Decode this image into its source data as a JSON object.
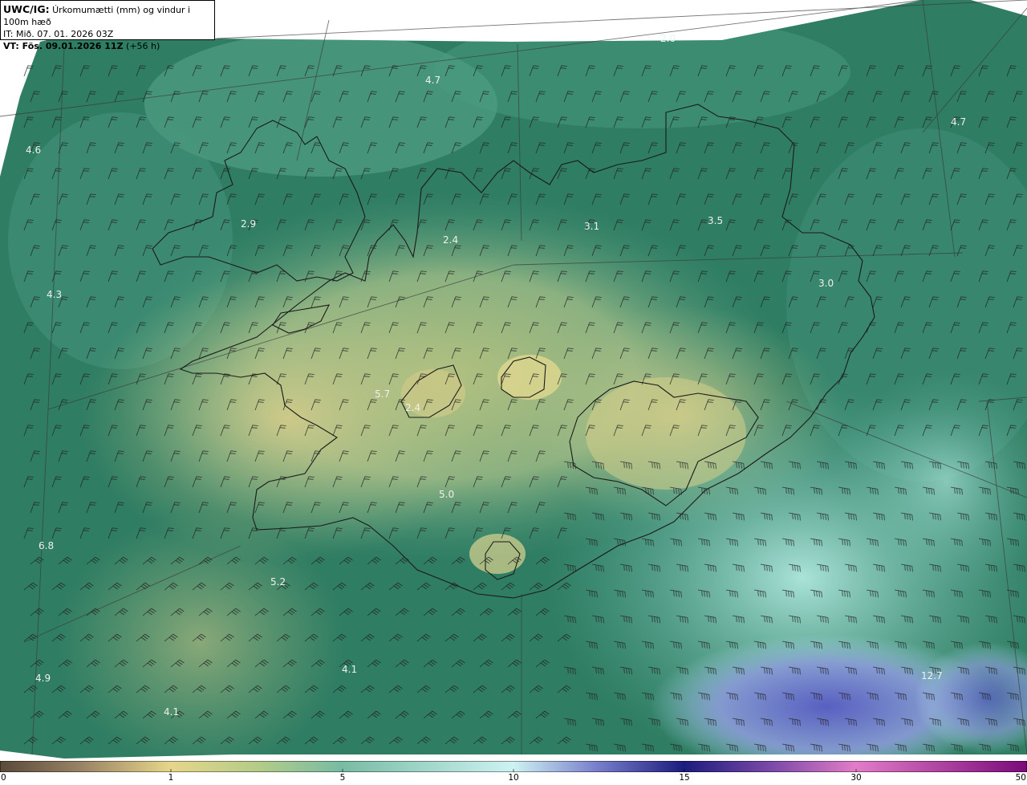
{
  "header": {
    "title_bold": "UWC/IG:",
    "title_rest": " Úrkomumætti (mm) og vindur i 100m hæð",
    "it_line": "IT: Mið. 07. 01. 2026 03Z",
    "vt_label": "VT:",
    "vt_bold": " Fös. 09.01.2026 11Z",
    "vt_rest": " (+56 h)"
  },
  "value_labels": [
    {
      "text": "4.7"
    },
    {
      "text": "2.0"
    },
    {
      "text": "4.7"
    },
    {
      "text": "4.6"
    },
    {
      "text": "2.9"
    },
    {
      "text": "3.1"
    },
    {
      "text": "3.5"
    },
    {
      "text": "2.4"
    },
    {
      "text": "4.3"
    },
    {
      "text": "3.0"
    },
    {
      "text": "5.7"
    },
    {
      "text": "2.4"
    },
    {
      "text": "5.0"
    },
    {
      "text": "6.8"
    },
    {
      "text": "5.2"
    },
    {
      "text": "4.1"
    },
    {
      "text": "4.9"
    },
    {
      "text": "4.1"
    },
    {
      "text": "12.7"
    }
  ],
  "colorbar": {
    "ticks": [
      "0",
      "1",
      "5",
      "10",
      "15",
      "30",
      "50"
    ],
    "colors": [
      "#5a4a3a",
      "#a08a6a",
      "#e8dc88",
      "#b8d490",
      "#7ac0a8",
      "#c8f0f0",
      "#7070c8",
      "#1a1a80",
      "#a050b0",
      "#e070c8",
      "#800080"
    ]
  }
}
